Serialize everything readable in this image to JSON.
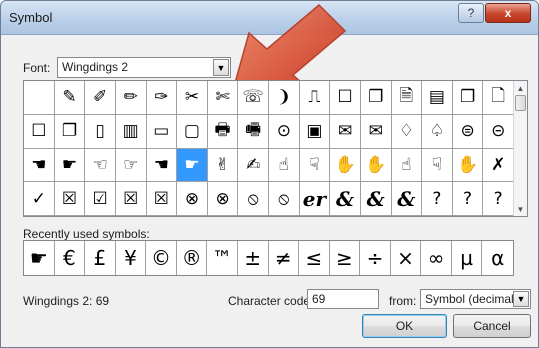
{
  "window": {
    "title": "Symbol",
    "help_glyph": "?",
    "close_glyph": "x"
  },
  "font": {
    "label": "Font:",
    "value": "Wingdings 2"
  },
  "grid_symbols": [
    "",
    "✎",
    "✐",
    "✏",
    "✑",
    "✂",
    "✄",
    "☏",
    "❩",
    "⎍",
    "☐",
    "❐",
    "🗎",
    "▤",
    "❐",
    "🗋",
    "☐",
    "❐",
    "▯",
    "▥",
    "▭",
    "▢",
    "🖶",
    "🖷",
    "⊙",
    "▣",
    "✉",
    "✉",
    "♢",
    "♤",
    "⊜",
    "⊝",
    "☚",
    "☛",
    "☜",
    "☞",
    "☚",
    "☛",
    "✌",
    "✍",
    "☝",
    "☟",
    "✋",
    "✋",
    "☝",
    "☟",
    "✋",
    "✗",
    "✓",
    "☒",
    "☑",
    "☒",
    "☒",
    "⊗",
    "⊗",
    "⦸",
    "⦸",
    "er",
    "&",
    "&",
    "&",
    "?",
    "?",
    "?"
  ],
  "selected_index": 37,
  "recent": {
    "label": "Recently used symbols:",
    "symbols": [
      "☛",
      "€",
      "£",
      "¥",
      "©",
      "®",
      "™",
      "±",
      "≠",
      "≤",
      "≥",
      "÷",
      "×",
      "∞",
      "µ",
      "α"
    ]
  },
  "status": "Wingdings 2: 69",
  "character_code": {
    "label": "Character code:",
    "value": "69"
  },
  "from": {
    "label": "from:",
    "value": "Symbol (decimal)"
  },
  "buttons": {
    "ok": "OK",
    "cancel": "Cancel"
  },
  "colors": {
    "selection": "#3399ff",
    "annotation_arrow": "#d9432a"
  }
}
